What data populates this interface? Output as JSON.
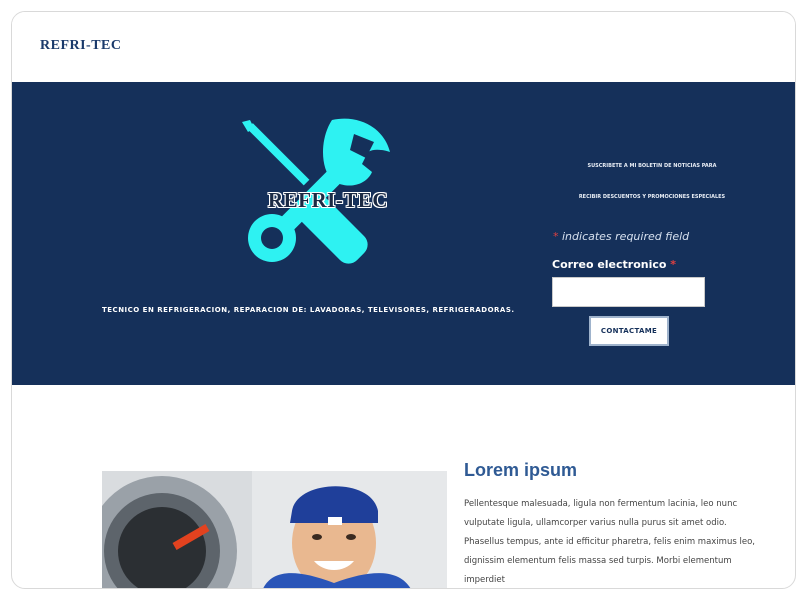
{
  "header": {
    "brand": "REFRI-TEC"
  },
  "hero": {
    "logo_text": "REFRI-TEC",
    "tagline": "TECNICO EN REFRIGERACION, REPARACION DE: LAVADORAS, TELEVISORES, REFRIGERADORAS.",
    "colors": {
      "background": "#15305a",
      "logo": "#2ef2f2"
    }
  },
  "subscribe": {
    "line1": "SUSCRIBETE A MI BOLETIN DE NOTICIAS PARA",
    "line2": "RECIBIR DESCUENTOS Y PROMOCIONES ESPECIALES",
    "required_star": "*",
    "required_note": " indicates required field",
    "email_label": "Correo electronico",
    "email_star": " *",
    "email_value": "",
    "submit_label": "CONTACTAME"
  },
  "content": {
    "title": "Lorem ipsum",
    "body": "Pellentesque malesuada, ligula non fermentum lacinia, leo nunc vulputate ligula, ullamcorper varius nulla purus sit amet odio. Phasellus tempus, ante id efficitur pharetra, felis enim maximus leo, dignissim elementum felis massa sed turpis. Morbi elementum imperdiet"
  }
}
